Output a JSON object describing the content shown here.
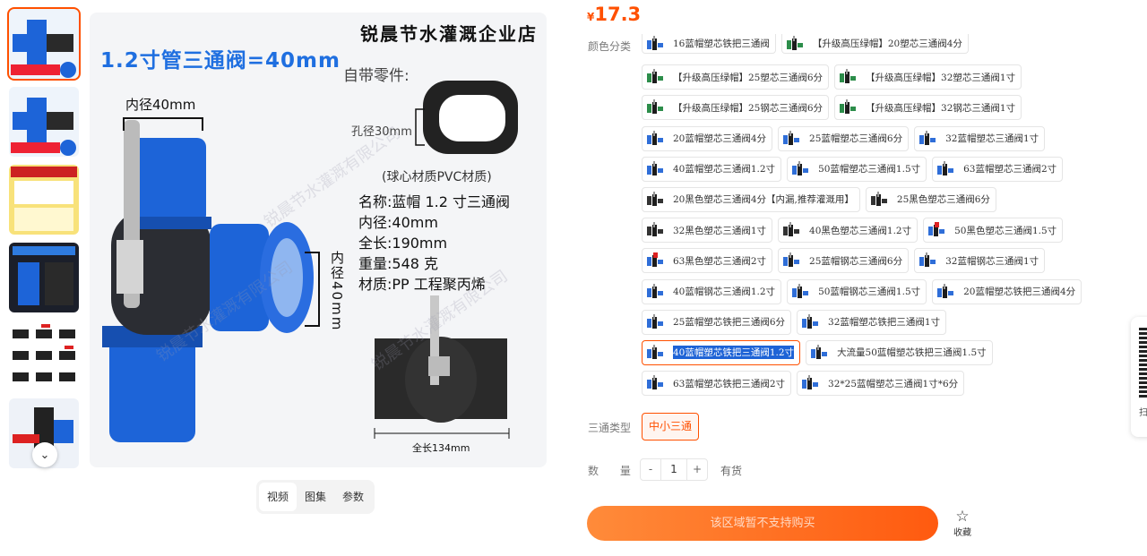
{
  "gallery": {
    "main_image": {
      "shop_name": "锐晨节水灌溉企业店",
      "headline": "1.2寸管三通阀=40mm",
      "subtitle": "自带零件:",
      "hole_label": "孔径30mm",
      "material_note": "(球心材质PVC材质)",
      "specs": [
        "名称:蓝帽 1.2 寸三通阀",
        "内径:40mm",
        "全长:190mm",
        "重量:548 克",
        "材质:PP 工程聚丙烯"
      ],
      "inner_top": "内径40mm",
      "inner_side": "内径40mm",
      "length_label": "全长134mm"
    },
    "tabs": [
      "视频",
      "图集",
      "参数"
    ]
  },
  "price": {
    "symbol": "¥",
    "value": "17.3"
  },
  "labels": {
    "color": "颜色分类",
    "type": "三通类型",
    "quantity": "数 量"
  },
  "skus": [
    [
      {
        "text": "16蓝帽塑芯铁把三通阀",
        "icon": "blue"
      },
      {
        "text": "【升级高压绿帽】20塑芯三通阀4分",
        "icon": "green"
      }
    ],
    [
      {
        "text": "【升级高压绿帽】25塑芯三通阀6分",
        "icon": "green"
      },
      {
        "text": "【升级高压绿帽】32塑芯三通阀1寸",
        "icon": "green"
      }
    ],
    [
      {
        "text": "【升级高压绿帽】25钢芯三通阀6分",
        "icon": "green"
      },
      {
        "text": "【升级高压绿帽】32钢芯三通阀1寸",
        "icon": "green"
      }
    ],
    [
      {
        "text": "20蓝帽塑芯三通阀4分",
        "icon": "blue"
      },
      {
        "text": "25蓝帽塑芯三通阀6分",
        "icon": "blue"
      },
      {
        "text": "32蓝帽塑芯三通阀1寸",
        "icon": "blue"
      }
    ],
    [
      {
        "text": "40蓝帽塑芯三通阀1.2寸",
        "icon": "blue"
      },
      {
        "text": "50蓝帽塑芯三通阀1.5寸",
        "icon": "blue"
      },
      {
        "text": "63蓝帽塑芯三通阀2寸",
        "icon": "blue"
      }
    ],
    [
      {
        "text": "20黑色塑芯三通阀4分【内漏,推荐灌溉用】",
        "icon": "black"
      },
      {
        "text": "25黑色塑芯三通阀6分",
        "icon": "black"
      }
    ],
    [
      {
        "text": "32黑色塑芯三通阀1寸",
        "icon": "black"
      },
      {
        "text": "40黑色塑芯三通阀1.2寸",
        "icon": "black"
      },
      {
        "text": "50黑色塑芯三通阀1.5寸",
        "icon": "red"
      }
    ],
    [
      {
        "text": "63黑色塑芯三通阀2寸",
        "icon": "red"
      },
      {
        "text": "25蓝帽钢芯三通阀6分",
        "icon": "blue"
      },
      {
        "text": "32蓝帽钢芯三通阀1寸",
        "icon": "blue"
      }
    ],
    [
      {
        "text": "40蓝帽钢芯三通阀1.2寸",
        "icon": "blue"
      },
      {
        "text": "50蓝帽钢芯三通阀1.5寸",
        "icon": "blue"
      },
      {
        "text": "20蓝帽塑芯铁把三通阀4分",
        "icon": "blue"
      }
    ],
    [
      {
        "text": "25蓝帽塑芯铁把三通阀6分",
        "icon": "blue"
      },
      {
        "text": "32蓝帽塑芯铁把三通阀1寸",
        "icon": "blue"
      }
    ],
    [
      {
        "text": "40蓝帽塑芯铁把三通阀1.2寸",
        "icon": "blue",
        "selected": true
      },
      {
        "text": "大流量50蓝帽塑芯铁把三通阀1.5寸",
        "icon": "blue"
      }
    ],
    [
      {
        "text": "63蓝帽塑芯铁把三通阀2寸",
        "icon": "blue"
      },
      {
        "text": "32*25蓝帽塑芯三通阀1寸*6分",
        "icon": "blue"
      }
    ]
  ],
  "type_option": "中小三通",
  "quantity": {
    "minus": "-",
    "value": "1",
    "plus": "+",
    "stock": "有货"
  },
  "buy_button": "该区域暂不支持购买",
  "favorite": {
    "icon": "star-outline-icon",
    "label": "收藏"
  },
  "qr_float": {
    "icon": "qr-code-icon",
    "label": "扫"
  },
  "colors": {
    "accent": "#ff5000",
    "selected_bg": "#1e63d6"
  }
}
